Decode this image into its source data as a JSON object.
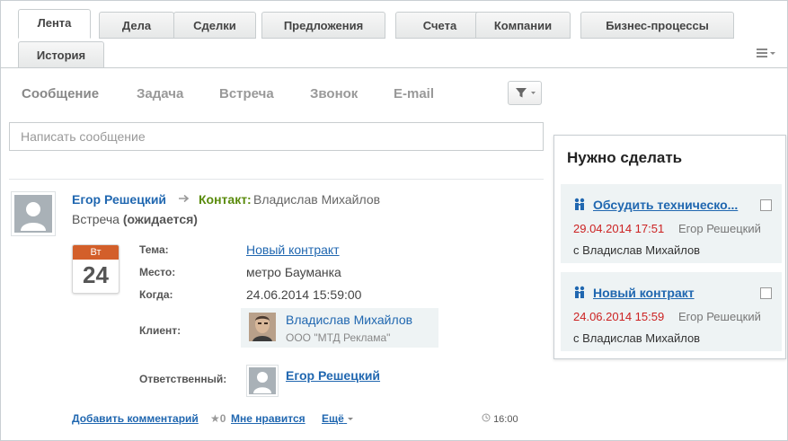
{
  "tabs": [
    "Лента",
    "Дела",
    "Сделки",
    "Предложения",
    "Счета",
    "Компании",
    "Бизнес-процессы",
    "История"
  ],
  "post_tabs": [
    "Сообщение",
    "Задача",
    "Встреча",
    "Звонок",
    "E-mail"
  ],
  "message_placeholder": "Написать сообщение",
  "post": {
    "author": "Егор Решецкий",
    "contact_label": "Контакт:",
    "contact_name": "Владислав Михайлов",
    "meeting_type": "Встреча",
    "meeting_status": "(ожидается)",
    "calendar": {
      "weekday": "Вт",
      "day": "24"
    },
    "fields": {
      "topic_label": "Тема:",
      "topic_value": "Новый контракт",
      "place_label": "Место:",
      "place_value": "метро Бауманка",
      "when_label": "Когда:",
      "when_value": "24.06.2014 15:59:00",
      "client_label": "Клиент:",
      "client_name": "Владислав Михайлов",
      "client_company": "ООО \"МТД Реклама\"",
      "responsible_label": "Ответственный:",
      "responsible_name": "Егор Решецкий"
    },
    "footer": {
      "add_comment": "Добавить комментарий",
      "likes_count": "0",
      "like": "Мне нравится",
      "more": "Ещё",
      "time": "16:00"
    }
  },
  "todo": {
    "title": "Нужно сделать",
    "items": [
      {
        "title": "Обсудить техническо...",
        "date": "29.04.2014 17:51",
        "owner": "Егор Решецкий",
        "with": "с Владислав Михайлов"
      },
      {
        "title": "Новый контракт",
        "date": "24.06.2014 15:59",
        "owner": "Егор Решецкий",
        "with": "с Владислав Михайлов"
      }
    ]
  },
  "colors": {
    "link": "#2067b0",
    "contact_green": "#5a8b0c",
    "date_red": "#c22222",
    "calendar_header": "#d35f2a"
  },
  "icons": [
    "menu-icon",
    "filter-icon",
    "arrow-right-icon",
    "user-placeholder-icon",
    "meeting-people-icon",
    "star-icon",
    "clock-icon"
  ]
}
